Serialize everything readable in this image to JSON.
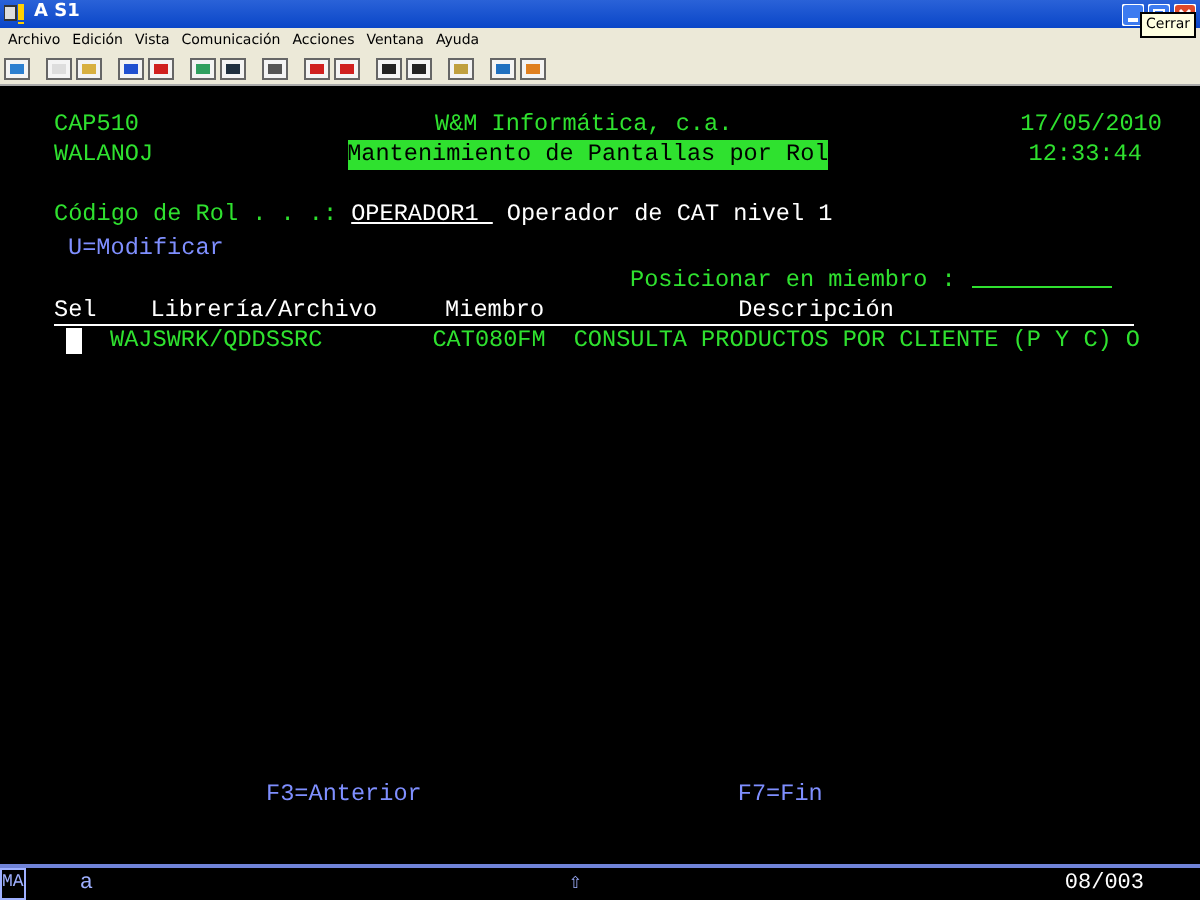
{
  "window": {
    "title": "A S1",
    "tooltip": "Cerrar"
  },
  "menu": [
    "Archivo",
    "Edición",
    "Vista",
    "Comunicación",
    "Acciones",
    "Ventana",
    "Ayuda"
  ],
  "header": {
    "program": "CAP510",
    "company": "W&M Informática, c.a.",
    "date": "17/05/2010",
    "user": "WALANOJ",
    "screen_title": "Mantenimiento de Pantallas por Rol",
    "time": "12:33:44"
  },
  "role": {
    "label": "Código de Rol . . .:",
    "value": "OPERADOR1",
    "description": "Operador de CAT nivel 1"
  },
  "options": "U=Modificar",
  "position": {
    "label": "Posicionar en miembro :"
  },
  "table": {
    "columns": [
      "Sel",
      "Librería/Archivo",
      "Miembro",
      "Descripción"
    ],
    "rows": [
      {
        "library": "WAJSWRK/QDDSSRC",
        "member": "CAT080FM",
        "description": "CONSULTA PRODUCTOS POR CLIENTE (P Y C) O",
        "cursor": true
      }
    ]
  },
  "function_keys": [
    "F3=Anterior",
    "F7=Fin"
  ],
  "status_bar": {
    "mode": "MA",
    "input": "a",
    "shift": "⇧",
    "position": "08/003"
  }
}
